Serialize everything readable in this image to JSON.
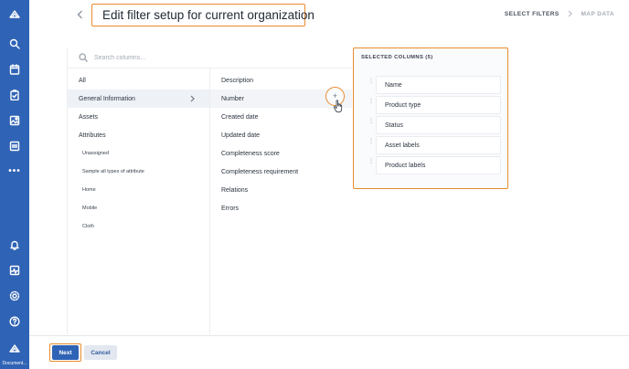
{
  "header": {
    "title": "Edit filter setup for current organization",
    "steps": [
      "SELECT FILTERS",
      "MAP DATA"
    ]
  },
  "search": {
    "placeholder": "Search columns..."
  },
  "categories": [
    {
      "label": "All"
    },
    {
      "label": "General Information"
    },
    {
      "label": "Assets"
    },
    {
      "label": "Attributes"
    },
    {
      "label": "Unassigned"
    },
    {
      "label": "Sample all types of attribute"
    },
    {
      "label": "Home"
    },
    {
      "label": "Mobile"
    },
    {
      "label": "Cloth"
    }
  ],
  "columns": [
    {
      "label": "Description"
    },
    {
      "label": "Number"
    },
    {
      "label": "Created date"
    },
    {
      "label": "Updated date"
    },
    {
      "label": "Completeness score"
    },
    {
      "label": "Completeness requirement"
    },
    {
      "label": "Relations"
    },
    {
      "label": "Errors"
    }
  ],
  "add_symbol": "+",
  "selected": {
    "title": "SELECTED COLUMNS (5)",
    "grip": "⋮",
    "items": [
      {
        "label": "Name"
      },
      {
        "label": "Product type"
      },
      {
        "label": "Status"
      },
      {
        "label": "Asset labels"
      },
      {
        "label": "Product labels"
      }
    ]
  },
  "footer": {
    "next_label": "Next",
    "cancel_label": "Cancel"
  },
  "nav": {
    "icons": [
      "logo-icon",
      "search-icon",
      "calendar-icon",
      "clipboard-check-icon",
      "image-icon",
      "pdf-icon",
      "more-icon",
      "bell-icon",
      "activity-icon",
      "gear-icon",
      "help-icon",
      "profile-logo-icon"
    ],
    "more_symbol": "•••",
    "bottom_label": "Document..."
  },
  "colors": {
    "nav_bg": "#2f63b5",
    "highlight": "#e88b2e",
    "primary": "#2f63b5",
    "cancel_bg": "#e3e8f0"
  }
}
